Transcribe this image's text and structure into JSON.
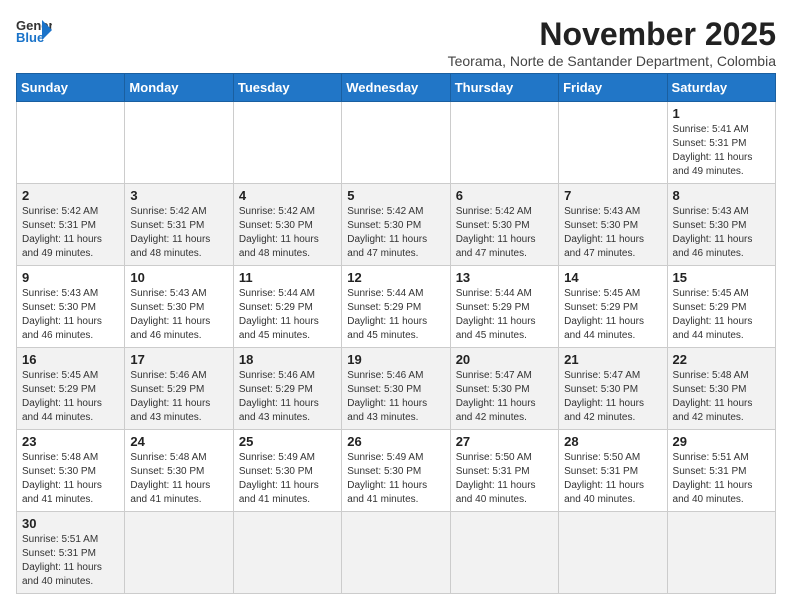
{
  "header": {
    "logo_general": "General",
    "logo_blue": "Blue",
    "month_year": "November 2025",
    "location": "Teorama, Norte de Santander Department, Colombia"
  },
  "weekdays": [
    "Sunday",
    "Monday",
    "Tuesday",
    "Wednesday",
    "Thursday",
    "Friday",
    "Saturday"
  ],
  "weeks": [
    [
      {
        "day": "",
        "info": ""
      },
      {
        "day": "",
        "info": ""
      },
      {
        "day": "",
        "info": ""
      },
      {
        "day": "",
        "info": ""
      },
      {
        "day": "",
        "info": ""
      },
      {
        "day": "",
        "info": ""
      },
      {
        "day": "1",
        "info": "Sunrise: 5:41 AM\nSunset: 5:31 PM\nDaylight: 11 hours and 49 minutes."
      }
    ],
    [
      {
        "day": "2",
        "info": "Sunrise: 5:42 AM\nSunset: 5:31 PM\nDaylight: 11 hours and 49 minutes."
      },
      {
        "day": "3",
        "info": "Sunrise: 5:42 AM\nSunset: 5:31 PM\nDaylight: 11 hours and 48 minutes."
      },
      {
        "day": "4",
        "info": "Sunrise: 5:42 AM\nSunset: 5:30 PM\nDaylight: 11 hours and 48 minutes."
      },
      {
        "day": "5",
        "info": "Sunrise: 5:42 AM\nSunset: 5:30 PM\nDaylight: 11 hours and 47 minutes."
      },
      {
        "day": "6",
        "info": "Sunrise: 5:42 AM\nSunset: 5:30 PM\nDaylight: 11 hours and 47 minutes."
      },
      {
        "day": "7",
        "info": "Sunrise: 5:43 AM\nSunset: 5:30 PM\nDaylight: 11 hours and 47 minutes."
      },
      {
        "day": "8",
        "info": "Sunrise: 5:43 AM\nSunset: 5:30 PM\nDaylight: 11 hours and 46 minutes."
      }
    ],
    [
      {
        "day": "9",
        "info": "Sunrise: 5:43 AM\nSunset: 5:30 PM\nDaylight: 11 hours and 46 minutes."
      },
      {
        "day": "10",
        "info": "Sunrise: 5:43 AM\nSunset: 5:30 PM\nDaylight: 11 hours and 46 minutes."
      },
      {
        "day": "11",
        "info": "Sunrise: 5:44 AM\nSunset: 5:29 PM\nDaylight: 11 hours and 45 minutes."
      },
      {
        "day": "12",
        "info": "Sunrise: 5:44 AM\nSunset: 5:29 PM\nDaylight: 11 hours and 45 minutes."
      },
      {
        "day": "13",
        "info": "Sunrise: 5:44 AM\nSunset: 5:29 PM\nDaylight: 11 hours and 45 minutes."
      },
      {
        "day": "14",
        "info": "Sunrise: 5:45 AM\nSunset: 5:29 PM\nDaylight: 11 hours and 44 minutes."
      },
      {
        "day": "15",
        "info": "Sunrise: 5:45 AM\nSunset: 5:29 PM\nDaylight: 11 hours and 44 minutes."
      }
    ],
    [
      {
        "day": "16",
        "info": "Sunrise: 5:45 AM\nSunset: 5:29 PM\nDaylight: 11 hours and 44 minutes."
      },
      {
        "day": "17",
        "info": "Sunrise: 5:46 AM\nSunset: 5:29 PM\nDaylight: 11 hours and 43 minutes."
      },
      {
        "day": "18",
        "info": "Sunrise: 5:46 AM\nSunset: 5:29 PM\nDaylight: 11 hours and 43 minutes."
      },
      {
        "day": "19",
        "info": "Sunrise: 5:46 AM\nSunset: 5:30 PM\nDaylight: 11 hours and 43 minutes."
      },
      {
        "day": "20",
        "info": "Sunrise: 5:47 AM\nSunset: 5:30 PM\nDaylight: 11 hours and 42 minutes."
      },
      {
        "day": "21",
        "info": "Sunrise: 5:47 AM\nSunset: 5:30 PM\nDaylight: 11 hours and 42 minutes."
      },
      {
        "day": "22",
        "info": "Sunrise: 5:48 AM\nSunset: 5:30 PM\nDaylight: 11 hours and 42 minutes."
      }
    ],
    [
      {
        "day": "23",
        "info": "Sunrise: 5:48 AM\nSunset: 5:30 PM\nDaylight: 11 hours and 41 minutes."
      },
      {
        "day": "24",
        "info": "Sunrise: 5:48 AM\nSunset: 5:30 PM\nDaylight: 11 hours and 41 minutes."
      },
      {
        "day": "25",
        "info": "Sunrise: 5:49 AM\nSunset: 5:30 PM\nDaylight: 11 hours and 41 minutes."
      },
      {
        "day": "26",
        "info": "Sunrise: 5:49 AM\nSunset: 5:30 PM\nDaylight: 11 hours and 41 minutes."
      },
      {
        "day": "27",
        "info": "Sunrise: 5:50 AM\nSunset: 5:31 PM\nDaylight: 11 hours and 40 minutes."
      },
      {
        "day": "28",
        "info": "Sunrise: 5:50 AM\nSunset: 5:31 PM\nDaylight: 11 hours and 40 minutes."
      },
      {
        "day": "29",
        "info": "Sunrise: 5:51 AM\nSunset: 5:31 PM\nDaylight: 11 hours and 40 minutes."
      }
    ],
    [
      {
        "day": "30",
        "info": "Sunrise: 5:51 AM\nSunset: 5:31 PM\nDaylight: 11 hours and 40 minutes."
      },
      {
        "day": "",
        "info": ""
      },
      {
        "day": "",
        "info": ""
      },
      {
        "day": "",
        "info": ""
      },
      {
        "day": "",
        "info": ""
      },
      {
        "day": "",
        "info": ""
      },
      {
        "day": "",
        "info": ""
      }
    ]
  ]
}
